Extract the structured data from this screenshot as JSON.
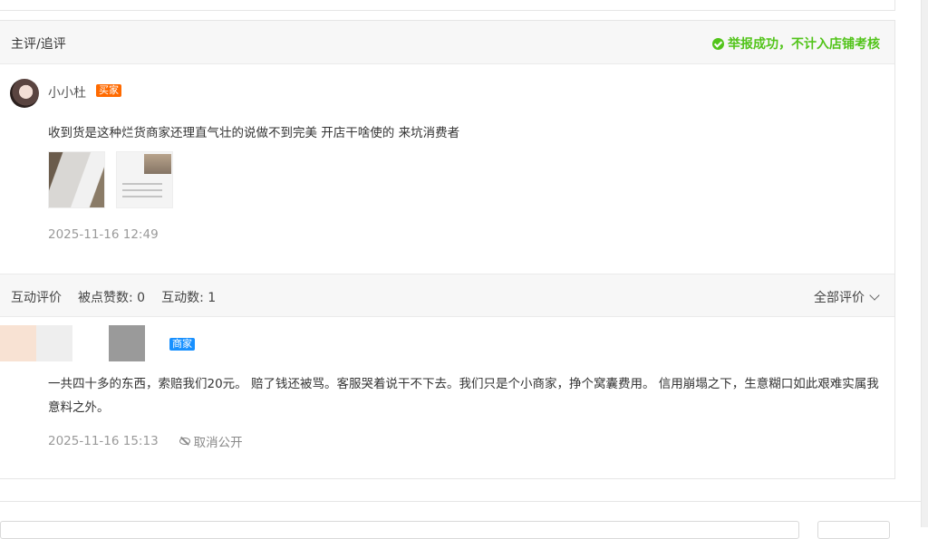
{
  "main_section": {
    "title": "主评/追评",
    "report_status": "举报成功，不计入店铺考核",
    "review": {
      "username": "小小杜",
      "role_tag": "买家",
      "content": "收到货是这种烂货商家还理直气壮的说做不到完美 开店干啥使的 来坑消费者",
      "photos": [
        "photo-1",
        "photo-2"
      ],
      "time": "2025-11-16 12:49"
    }
  },
  "interaction_section": {
    "title": "互动评价",
    "likes_label": "被点赞数: 0",
    "interactions_label": "互动数: 1",
    "all_reviews_label": "全部评价"
  },
  "reply": {
    "role_tag": "商家",
    "content": "一共四十多的东西，索赔我们20元。 赔了钱还被骂。客服哭着说干不下去。我们只是个小商家，挣个窝囊费用。 信用崩塌之下，生意糊口如此艰难实属我意料之外。",
    "time": "2025-11-16 15:13",
    "hide_action": "取消公开"
  },
  "colors": {
    "success": "#52c41a",
    "buyer_tag": "#ff6a00",
    "merchant_tag": "#1890ff"
  },
  "icons": {
    "report_status": "check-circle-icon",
    "dropdown": "chevron-down-icon",
    "hide": "eye-off-icon"
  }
}
